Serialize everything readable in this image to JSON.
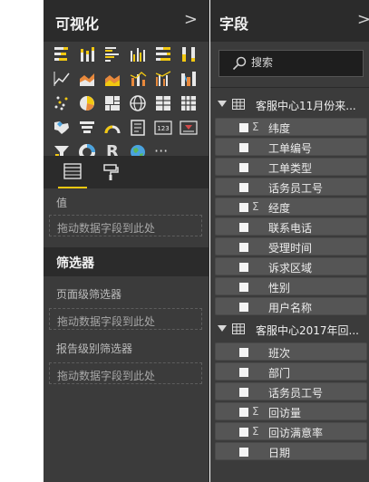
{
  "visualizations": {
    "title": "可视化",
    "icons": [
      "stacked-bar-icon",
      "stacked-column-icon",
      "clustered-bar-icon",
      "clustered-column-icon",
      "100-bar-icon",
      "100-column-icon",
      "line-chart-icon",
      "area-chart-icon",
      "stacked-area-icon",
      "line-column-icon",
      "line-clustered-column-icon",
      "ribbon-chart-icon",
      "scatter-chart-icon",
      "pie-chart-icon",
      "treemap-icon",
      "map-icon",
      "table-icon",
      "matrix-icon",
      "filled-map-icon",
      "funnel-icon",
      "gauge-icon",
      "multi-row-card-icon",
      "card-icon",
      "kpi-icon",
      "slicer-icon",
      "donut-chart-icon",
      "r-visual-icon",
      "globe-icon",
      "more-icon"
    ],
    "icon_more_glyph": "···",
    "r_glyph": "R",
    "card_glyph": "123",
    "values_label": "值",
    "values_drop": "拖动数据字段到此处"
  },
  "filters": {
    "title": "筛选器",
    "page_level_label": "页面级筛选器",
    "page_level_drop": "拖动数据字段到此处",
    "report_level_label": "报告级别筛选器",
    "report_level_drop": "拖动数据字段到此处"
  },
  "fields": {
    "title": "字段",
    "search_placeholder": "搜索",
    "tables": [
      {
        "name": "客服中心11月份来...",
        "fields": [
          {
            "label": "纬度",
            "sigma": "Σ"
          },
          {
            "label": "工单编号",
            "sigma": ""
          },
          {
            "label": "工单类型",
            "sigma": ""
          },
          {
            "label": "话务员工号",
            "sigma": ""
          },
          {
            "label": "经度",
            "sigma": "Σ"
          },
          {
            "label": "联系电话",
            "sigma": ""
          },
          {
            "label": "受理时间",
            "sigma": ""
          },
          {
            "label": "诉求区域",
            "sigma": ""
          },
          {
            "label": "性别",
            "sigma": ""
          },
          {
            "label": "用户名称",
            "sigma": ""
          }
        ]
      },
      {
        "name": "客服中心2017年回...",
        "fields": [
          {
            "label": "班次",
            "sigma": ""
          },
          {
            "label": "部门",
            "sigma": ""
          },
          {
            "label": "话务员工号",
            "sigma": ""
          },
          {
            "label": "回访量",
            "sigma": "Σ"
          },
          {
            "label": "回访满意率",
            "sigma": "Σ"
          },
          {
            "label": "日期",
            "sigma": ""
          }
        ]
      }
    ]
  },
  "header_chevron": ">"
}
